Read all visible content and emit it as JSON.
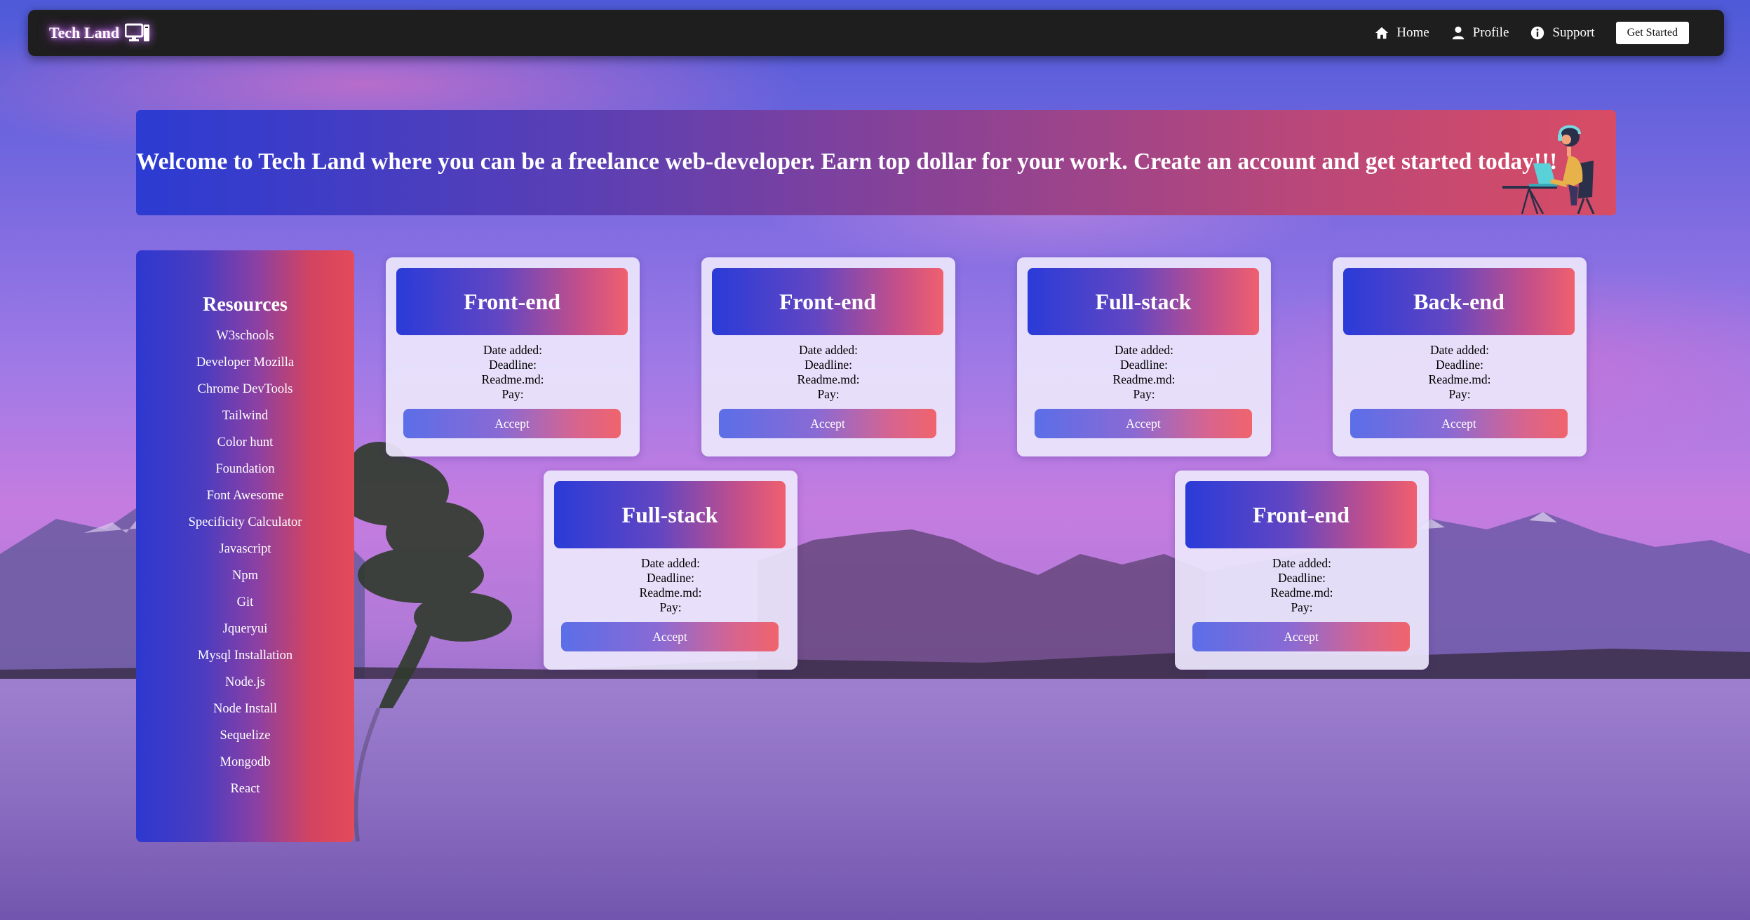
{
  "brand": {
    "name": "Tech Land",
    "icon": "computer-monitor-icon"
  },
  "nav": {
    "links": [
      {
        "label": "Home",
        "icon": "home-icon"
      },
      {
        "label": "Profile",
        "icon": "user-icon"
      },
      {
        "label": "Support",
        "icon": "info-circle-icon"
      }
    ],
    "cta_label": "Get Started"
  },
  "banner": {
    "text": "Welcome to Tech Land where you can be a freelance web-developer. Earn top dollar for your work. Create an account and get started today!!!",
    "figure": "person-at-laptop-illustration"
  },
  "sidebar": {
    "title": "Resources",
    "items": [
      "W3schools",
      "Developer Mozilla",
      "Chrome DevTools",
      "Tailwind",
      "Color hunt",
      "Foundation",
      "Font Awesome",
      "Specificity Calculator",
      "Javascript",
      "Npm",
      "Git",
      "Jqueryui",
      "Mysql Installation",
      "Node.js",
      "Node Install",
      "Sequelize",
      "Mongodb",
      "React"
    ]
  },
  "jobs": [
    {
      "title": "Front-end",
      "date_label": "Date added:",
      "deadline_label": "Deadline:",
      "readme_label": "Readme.md:",
      "pay_label": "Pay:",
      "button": "Accept"
    },
    {
      "title": "Front-end",
      "date_label": "Date added:",
      "deadline_label": "Deadline:",
      "readme_label": "Readme.md:",
      "pay_label": "Pay:",
      "button": "Accept"
    },
    {
      "title": "Full-stack",
      "date_label": "Date added:",
      "deadline_label": "Deadline:",
      "readme_label": "Readme.md:",
      "pay_label": "Pay:",
      "button": "Accept"
    },
    {
      "title": "Back-end",
      "date_label": "Date added:",
      "deadline_label": "Deadline:",
      "readme_label": "Readme.md:",
      "pay_label": "Pay:",
      "button": "Accept"
    },
    {
      "title": "Full-stack",
      "date_label": "Date added:",
      "deadline_label": "Deadline:",
      "readme_label": "Readme.md:",
      "pay_label": "Pay:",
      "button": "Accept"
    },
    {
      "title": "Front-end",
      "date_label": "Date added:",
      "deadline_label": "Deadline:",
      "readme_label": "Readme.md:",
      "pay_label": "Pay:",
      "button": "Accept"
    }
  ],
  "colors": {
    "navbar": "#1e1e1e",
    "gradient_blue": "#2c3bd2",
    "gradient_red": "#e44a5a",
    "card_bg": "#ece6fc"
  }
}
